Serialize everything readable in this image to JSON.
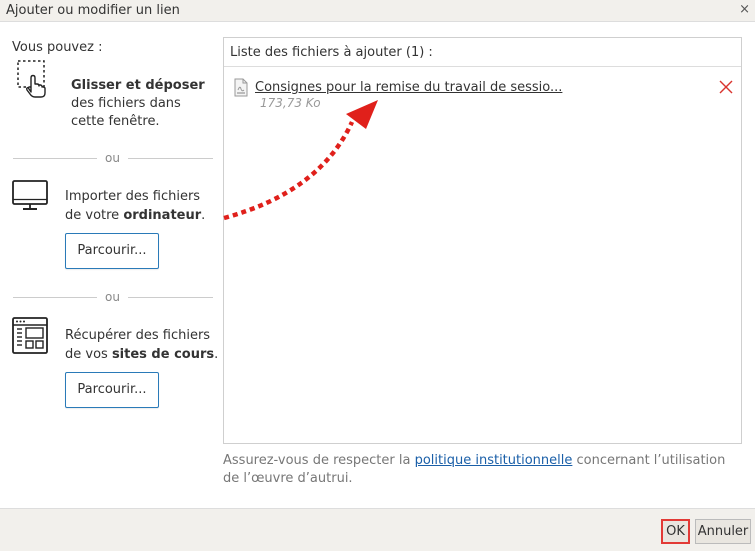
{
  "window": {
    "title": "Ajouter ou modifier un lien",
    "close_glyph": "×"
  },
  "left": {
    "intro": "Vous pouvez :",
    "drag": {
      "icon": "drag-drop-icon",
      "bold": "Glisser et déposer",
      "line2": "des fichiers dans",
      "line3": "cette fenêtre."
    },
    "or1": "ou",
    "computer": {
      "icon": "monitor-icon",
      "line1": "Importer des fichiers",
      "line2_pre": "de votre ",
      "line2_bold": "ordinateur",
      "line2_post": ".",
      "button": "Parcourir..."
    },
    "or2": "ou",
    "courses": {
      "icon": "course-sites-icon",
      "line1": "Récupérer des fichiers",
      "line2_pre": "de vos ",
      "line2_bold": "sites de cours",
      "line2_post": ".",
      "button": "Parcourir..."
    }
  },
  "panel": {
    "header": "Liste des fichiers à ajouter (1) :",
    "files": [
      {
        "name": "Consignes pour la remise du travail de sessio...",
        "size": "173,73 Ko",
        "icon": "pdf-file-icon",
        "remove_icon": "remove-icon"
      }
    ]
  },
  "note": {
    "pre": "Assurez-vous de respecter la ",
    "link": "politique institutionnelle",
    "post": " concernant l’utilisation de l’œuvre d’autrui."
  },
  "footer": {
    "ok": "OK",
    "cancel": "Annuler"
  },
  "colors": {
    "accent_border": "#2a7ab8",
    "arrow": "#e0201b",
    "ok_highlight": "#e23a36",
    "link": "#1a5fa8"
  }
}
